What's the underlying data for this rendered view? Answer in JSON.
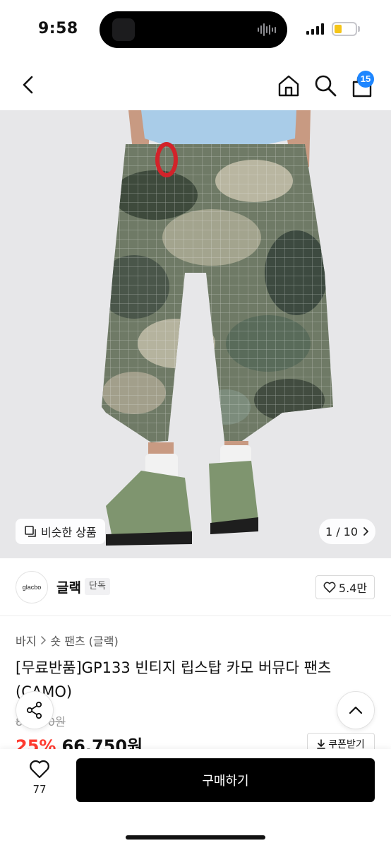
{
  "status": {
    "time": "9:58"
  },
  "nav": {
    "cart_count": "15"
  },
  "hero": {
    "similar_label": "비슷한 상품",
    "counter": "1 / 10"
  },
  "brand": {
    "name": "글랙",
    "tag": "단독",
    "logo_text": "glacbo",
    "likes": "5.4만"
  },
  "breadcrumb": [
    "바지",
    "숏 팬츠 (글랙)"
  ],
  "product": {
    "title": "[무료반품]GP133 빈티지 립스탑 카모 버뮤다 팬츠 (CAMO)",
    "original_price": "89,000원",
    "discount": "25%",
    "sale_price": "66,750원",
    "coupon_label": "쿠폰받기"
  },
  "bottom": {
    "wish_count": "77",
    "buy_label": "구매하기"
  },
  "colors": {
    "accent": "#1e86ff",
    "sale": "#ff3b30",
    "buy": "#000000"
  }
}
